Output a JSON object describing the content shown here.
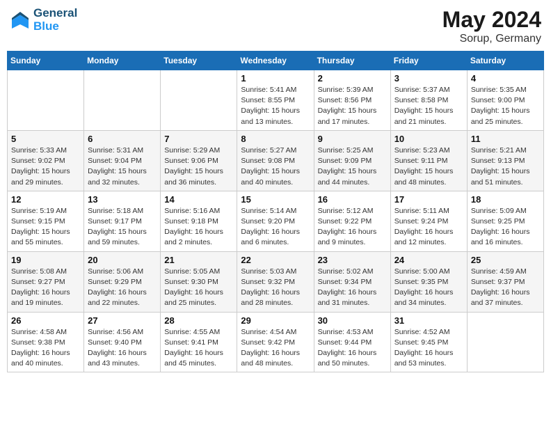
{
  "header": {
    "logo_line1": "General",
    "logo_line2": "Blue",
    "month": "May 2024",
    "location": "Sorup, Germany"
  },
  "days_of_week": [
    "Sunday",
    "Monday",
    "Tuesday",
    "Wednesday",
    "Thursday",
    "Friday",
    "Saturday"
  ],
  "weeks": [
    [
      {
        "day": "",
        "info": ""
      },
      {
        "day": "",
        "info": ""
      },
      {
        "day": "",
        "info": ""
      },
      {
        "day": "1",
        "info": "Sunrise: 5:41 AM\nSunset: 8:55 PM\nDaylight: 15 hours\nand 13 minutes."
      },
      {
        "day": "2",
        "info": "Sunrise: 5:39 AM\nSunset: 8:56 PM\nDaylight: 15 hours\nand 17 minutes."
      },
      {
        "day": "3",
        "info": "Sunrise: 5:37 AM\nSunset: 8:58 PM\nDaylight: 15 hours\nand 21 minutes."
      },
      {
        "day": "4",
        "info": "Sunrise: 5:35 AM\nSunset: 9:00 PM\nDaylight: 15 hours\nand 25 minutes."
      }
    ],
    [
      {
        "day": "5",
        "info": "Sunrise: 5:33 AM\nSunset: 9:02 PM\nDaylight: 15 hours\nand 29 minutes."
      },
      {
        "day": "6",
        "info": "Sunrise: 5:31 AM\nSunset: 9:04 PM\nDaylight: 15 hours\nand 32 minutes."
      },
      {
        "day": "7",
        "info": "Sunrise: 5:29 AM\nSunset: 9:06 PM\nDaylight: 15 hours\nand 36 minutes."
      },
      {
        "day": "8",
        "info": "Sunrise: 5:27 AM\nSunset: 9:08 PM\nDaylight: 15 hours\nand 40 minutes."
      },
      {
        "day": "9",
        "info": "Sunrise: 5:25 AM\nSunset: 9:09 PM\nDaylight: 15 hours\nand 44 minutes."
      },
      {
        "day": "10",
        "info": "Sunrise: 5:23 AM\nSunset: 9:11 PM\nDaylight: 15 hours\nand 48 minutes."
      },
      {
        "day": "11",
        "info": "Sunrise: 5:21 AM\nSunset: 9:13 PM\nDaylight: 15 hours\nand 51 minutes."
      }
    ],
    [
      {
        "day": "12",
        "info": "Sunrise: 5:19 AM\nSunset: 9:15 PM\nDaylight: 15 hours\nand 55 minutes."
      },
      {
        "day": "13",
        "info": "Sunrise: 5:18 AM\nSunset: 9:17 PM\nDaylight: 15 hours\nand 59 minutes."
      },
      {
        "day": "14",
        "info": "Sunrise: 5:16 AM\nSunset: 9:18 PM\nDaylight: 16 hours\nand 2 minutes."
      },
      {
        "day": "15",
        "info": "Sunrise: 5:14 AM\nSunset: 9:20 PM\nDaylight: 16 hours\nand 6 minutes."
      },
      {
        "day": "16",
        "info": "Sunrise: 5:12 AM\nSunset: 9:22 PM\nDaylight: 16 hours\nand 9 minutes."
      },
      {
        "day": "17",
        "info": "Sunrise: 5:11 AM\nSunset: 9:24 PM\nDaylight: 16 hours\nand 12 minutes."
      },
      {
        "day": "18",
        "info": "Sunrise: 5:09 AM\nSunset: 9:25 PM\nDaylight: 16 hours\nand 16 minutes."
      }
    ],
    [
      {
        "day": "19",
        "info": "Sunrise: 5:08 AM\nSunset: 9:27 PM\nDaylight: 16 hours\nand 19 minutes."
      },
      {
        "day": "20",
        "info": "Sunrise: 5:06 AM\nSunset: 9:29 PM\nDaylight: 16 hours\nand 22 minutes."
      },
      {
        "day": "21",
        "info": "Sunrise: 5:05 AM\nSunset: 9:30 PM\nDaylight: 16 hours\nand 25 minutes."
      },
      {
        "day": "22",
        "info": "Sunrise: 5:03 AM\nSunset: 9:32 PM\nDaylight: 16 hours\nand 28 minutes."
      },
      {
        "day": "23",
        "info": "Sunrise: 5:02 AM\nSunset: 9:34 PM\nDaylight: 16 hours\nand 31 minutes."
      },
      {
        "day": "24",
        "info": "Sunrise: 5:00 AM\nSunset: 9:35 PM\nDaylight: 16 hours\nand 34 minutes."
      },
      {
        "day": "25",
        "info": "Sunrise: 4:59 AM\nSunset: 9:37 PM\nDaylight: 16 hours\nand 37 minutes."
      }
    ],
    [
      {
        "day": "26",
        "info": "Sunrise: 4:58 AM\nSunset: 9:38 PM\nDaylight: 16 hours\nand 40 minutes."
      },
      {
        "day": "27",
        "info": "Sunrise: 4:56 AM\nSunset: 9:40 PM\nDaylight: 16 hours\nand 43 minutes."
      },
      {
        "day": "28",
        "info": "Sunrise: 4:55 AM\nSunset: 9:41 PM\nDaylight: 16 hours\nand 45 minutes."
      },
      {
        "day": "29",
        "info": "Sunrise: 4:54 AM\nSunset: 9:42 PM\nDaylight: 16 hours\nand 48 minutes."
      },
      {
        "day": "30",
        "info": "Sunrise: 4:53 AM\nSunset: 9:44 PM\nDaylight: 16 hours\nand 50 minutes."
      },
      {
        "day": "31",
        "info": "Sunrise: 4:52 AM\nSunset: 9:45 PM\nDaylight: 16 hours\nand 53 minutes."
      },
      {
        "day": "",
        "info": ""
      }
    ]
  ]
}
